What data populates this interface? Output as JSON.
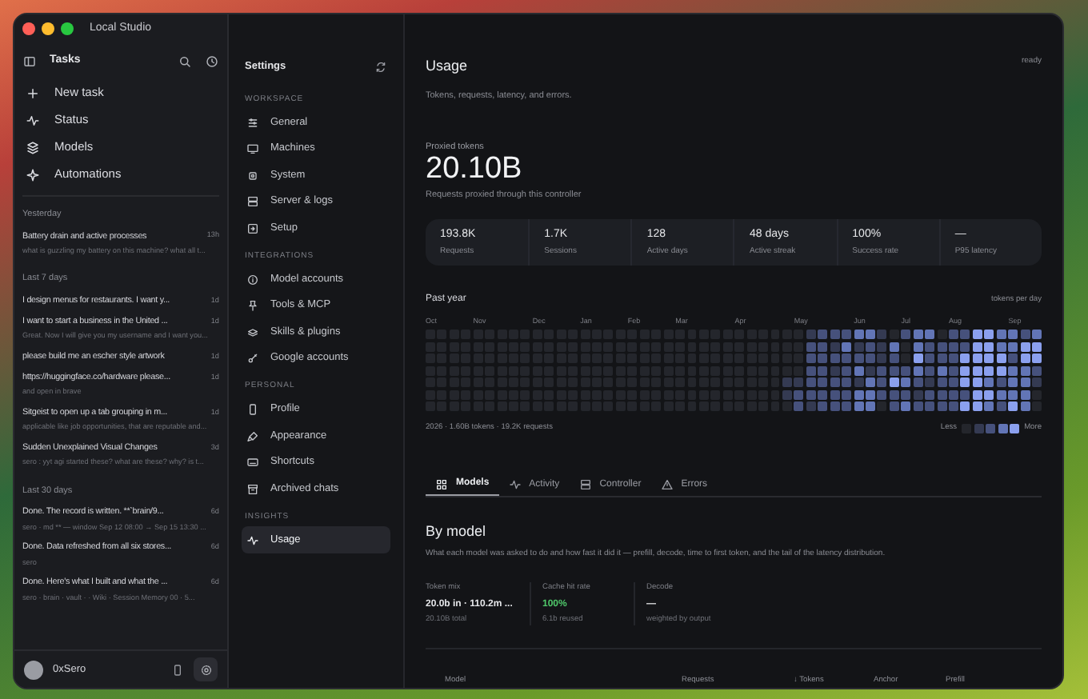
{
  "window": {
    "title": "Local Studio"
  },
  "sidebar": {
    "title": "Tasks",
    "nav": [
      {
        "label": "New task"
      },
      {
        "label": "Status"
      },
      {
        "label": "Models"
      },
      {
        "label": "Automations"
      }
    ],
    "groups": [
      {
        "label": "Yesterday",
        "tasks": [
          {
            "title": "Battery drain and active processes",
            "time": "13h",
            "preview": "what is guzzling my battery on this machine? what all t..."
          }
        ]
      },
      {
        "label": "Last 7 days",
        "tasks": [
          {
            "title": "I design menus for restaurants. I want y...",
            "time": "1d"
          },
          {
            "title": "I want to start a business in the United ...",
            "time": "1d",
            "preview": "Great. Now I will give you my username and I want you..."
          },
          {
            "title": "please build me an escher style artwork",
            "time": "1d"
          },
          {
            "title": "https://huggingface.co/hardware please...",
            "time": "1d",
            "preview": "and open in brave"
          },
          {
            "title": "Sitgeist to open up a tab grouping in m...",
            "time": "1d",
            "preview": "applicable like job opportunities, that are reputable and..."
          },
          {
            "title": "Sudden Unexplained Visual Changes",
            "time": "3d",
            "preview": "sero : yyt agi started these? what are these? why? is t..."
          }
        ]
      },
      {
        "label": "Last 30 days",
        "tasks": [
          {
            "title": "Done. The record is written. **`brain/9...",
            "time": "6d",
            "preview": "sero · md ** — window Sep 12 08:00 → Sep 15 13:30 ..."
          },
          {
            "title": "Done. Data refreshed from all six stores...",
            "time": "6d",
            "preview": "sero"
          },
          {
            "title": "Done. Here's what I built and what the ...",
            "time": "6d",
            "preview": "sero · brain · vault · · Wiki · Session Memory 00 · 5..."
          }
        ]
      }
    ],
    "user": {
      "name": "0xSero"
    }
  },
  "settings": {
    "title": "Settings",
    "sections": [
      {
        "label": "WORKSPACE",
        "items": [
          {
            "label": "General",
            "selected": false
          },
          {
            "label": "Machines",
            "selected": false
          },
          {
            "label": "System",
            "selected": false
          },
          {
            "label": "Server & logs",
            "selected": false
          },
          {
            "label": "Setup",
            "selected": false
          }
        ]
      },
      {
        "label": "INTEGRATIONS",
        "items": [
          {
            "label": "Model accounts",
            "selected": false
          },
          {
            "label": "Tools & MCP",
            "selected": false
          },
          {
            "label": "Skills & plugins",
            "selected": false
          },
          {
            "label": "Google accounts",
            "selected": false
          }
        ]
      },
      {
        "label": "PERSONAL",
        "items": [
          {
            "label": "Profile",
            "selected": false
          },
          {
            "label": "Appearance",
            "selected": false
          },
          {
            "label": "Shortcuts",
            "selected": false
          },
          {
            "label": "Archived chats",
            "selected": false
          }
        ]
      },
      {
        "label": "INSIGHTS",
        "items": [
          {
            "label": "Usage",
            "selected": true
          }
        ]
      }
    ]
  },
  "usage": {
    "title": "Usage",
    "status": "ready",
    "subtitle": "Tokens, requests, latency, and errors.",
    "hero": {
      "label": "Proxied tokens",
      "value": "20.10B",
      "caption": "Requests proxied through this controller"
    },
    "stats": [
      {
        "value": "193.8K",
        "label": "Requests"
      },
      {
        "value": "1.7K",
        "label": "Sessions"
      },
      {
        "value": "128",
        "label": "Active days"
      },
      {
        "value": "48 days",
        "label": "Active streak"
      },
      {
        "value": "100%",
        "label": "Success rate"
      },
      {
        "value": "—",
        "label": "P95 latency"
      }
    ],
    "heatmap": {
      "title": "Past year",
      "unit": "tokens per day",
      "months": [
        "Oct",
        "Nov",
        "Dec",
        "Jan",
        "Feb",
        "Mar",
        "Apr",
        "May",
        "Jun",
        "Jul",
        "Aug",
        "Sep"
      ],
      "summary": "2026 · 1.60B tokens · 19.2K requests",
      "less": "Less",
      "more": "More"
    },
    "tabs": [
      {
        "label": "Models",
        "selected": true
      },
      {
        "label": "Activity",
        "selected": false
      },
      {
        "label": "Controller",
        "selected": false
      },
      {
        "label": "Errors",
        "selected": false
      }
    ],
    "by_model": {
      "title": "By model",
      "description": "What each model was asked to do and how fast it did it — prefill, decode, time to first token, and the tail of the latency distribution.",
      "metrics": [
        {
          "label": "Token mix",
          "value": "20.0b in · 110.2m ...",
          "note": "20.10B total",
          "kind": "plain"
        },
        {
          "label": "Cache hit rate",
          "value": "100%",
          "note": "6.1b reused",
          "kind": "good"
        },
        {
          "label": "Decode",
          "value": "—",
          "note": "weighted by output",
          "kind": "plain"
        }
      ],
      "columns": [
        "Model",
        "Requests",
        "↓ Tokens",
        "Anchor",
        "Prefill"
      ]
    }
  }
}
